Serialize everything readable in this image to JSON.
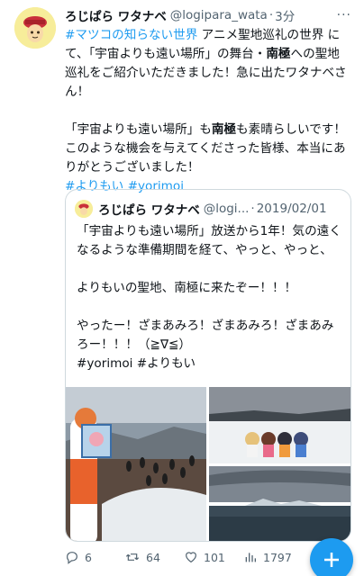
{
  "colors": {
    "accent": "#1d9bf0",
    "text": "#0f1419",
    "secondary": "#536471",
    "border": "#cfd9de"
  },
  "tweet": {
    "display_name": "ろじぱら ワタナベ",
    "handle": "@logipara_wata",
    "separator": "·",
    "time": "3分",
    "more": "···",
    "p1_hashtag": "#マツコの知らない世界",
    "p1_text_a": " アニメ聖地巡礼の世界 にて、「宇宙よりも遠い場所」の舞台・",
    "p1_bold": "南極",
    "p1_text_b": "への聖地巡礼をご紹介いただきました！急に出たワタナベさん！",
    "p2_text_a": "「宇宙よりも遠い場所」も",
    "p2_bold": "南極",
    "p2_text_b": "も素晴らしいです！このような機会を与えてくださった皆様、本当にありがとうございました！",
    "hashtag_a": "#よりもい",
    "hashtag_b": "#yorimoi"
  },
  "quote": {
    "display_name": "ろじぱら ワタナベ",
    "handle": "@logi...",
    "separator": "·",
    "date": "2019/02/01",
    "line1": "「宇宙よりも遠い場所」放送から1年！気の遠くなるような準備期間を経て、やっと、やっと、",
    "line2": "よりもいの聖地、南極に来たぞー！！！",
    "line3": "やったー！ざまあみろ！ざまあみろ！ざまあみろー！！！（≧∇≦）",
    "line4": "#yorimoi #よりもい"
  },
  "actions": {
    "reply_count": "6",
    "retweet_count": "64",
    "like_count": "101",
    "views_count": "1797",
    "reply_icon": "reply-icon",
    "retweet_icon": "retweet-icon",
    "like_icon": "heart-icon",
    "views_icon": "views-icon",
    "compose_icon": "plus-icon"
  }
}
